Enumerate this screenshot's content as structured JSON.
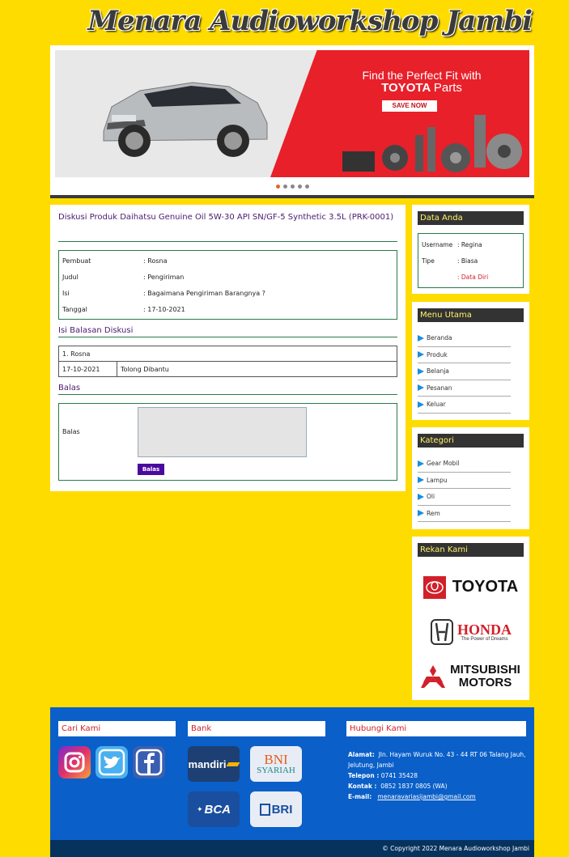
{
  "site": {
    "title": "Menara Audioworkshop Jambi"
  },
  "banner": {
    "headline": "Find the Perfect Fit with",
    "brand": "TOYOTA",
    "brand_suffix": "Parts",
    "cta": "SAVE NOW",
    "slide_count": 5,
    "active_slide": 1
  },
  "main": {
    "title": "Diskusi Produk Daihatsu Genuine Oil 5W-30 API SN/GF-5 Synthetic 3.5L (PRK-0001)",
    "info": [
      {
        "label": "Pembuat",
        "value": ": Rosna"
      },
      {
        "label": "Judul",
        "value": ": Pengiriman"
      },
      {
        "label": "Isi",
        "value": ": Bagaimana Pengiriman Barangnya ?"
      },
      {
        "label": "Tanggal",
        "value": ": 17-10-2021"
      }
    ],
    "replies_title": "Isi Balasan Diskusi",
    "reply": {
      "author": "1. Rosna",
      "date": "17-10-2021",
      "text": "Tolong Dibantu"
    },
    "form_title": "Balas",
    "form_label": "Balas",
    "form_button": "Balas",
    "form_value": ""
  },
  "sidebar": {
    "user": {
      "title": "Data Anda",
      "username_label": "Username",
      "username_value": ": Regina",
      "type_label": "Tipe",
      "type_value": ": Biasa",
      "link": ": Data Diri"
    },
    "menu": {
      "title": "Menu Utama",
      "items": [
        "Beranda",
        "Produk",
        "Belanja",
        "Pesanan",
        "Keluar"
      ]
    },
    "categories": {
      "title": "Kategori",
      "items": [
        "Gear Mobil",
        "Lampu",
        "Oli",
        "Rem"
      ]
    },
    "partners": {
      "title": "Rekan Kami",
      "items": [
        {
          "name": "TOYOTA"
        },
        {
          "name": "HONDA",
          "tagline": "The Power of Dreams"
        },
        {
          "name": "MITSUBISHI",
          "name2": "MOTORS"
        }
      ]
    }
  },
  "footer": {
    "find_title": "Cari Kami",
    "bank_title": "Bank",
    "banks": [
      "mandiri",
      "BNI",
      "SYARIAH",
      "BCA",
      "BRI"
    ],
    "contact_title": "Hubungi Kami",
    "address_label": "Alamat:",
    "address": "Jln. Hayam Wuruk No. 43 - 44 RT 06 Talang Jauh, Jelutung, Jambi",
    "phone_label": "Telepon :",
    "phone": "0741 35428",
    "contact_label": "Kontak :",
    "contact": "0852 1837 0805 (WA)",
    "email_label": "E-mail:",
    "email": "menaravariasijambi@gmail.com",
    "copyright": "© Copyright 2022 Menara Audioworkshop Jambi"
  },
  "colors": {
    "background": "#ffdc00",
    "accent_red": "#d2202a",
    "footer_blue": "#0a5fc8",
    "heading_purple": "#4a1a6e",
    "button_purple": "#4a0aa0"
  }
}
